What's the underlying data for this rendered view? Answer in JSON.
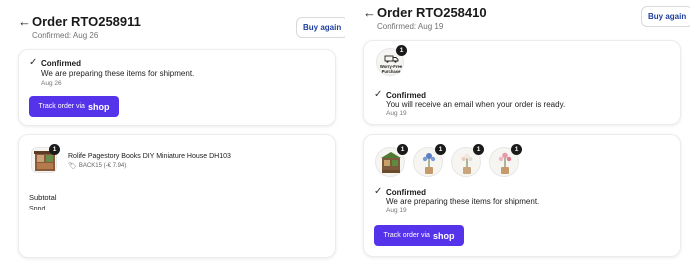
{
  "left_order": {
    "title": "Order RTO258911",
    "subtitle": "Confirmed: Aug 26",
    "buy_again": "Buy again",
    "status": {
      "title": "Confirmed",
      "message": "We are preparing these items for shipment.",
      "date": "Aug 26"
    },
    "track": {
      "label": "Track order via",
      "brand": "shop"
    },
    "item": {
      "quantity": "1",
      "name": "Rolife Pagestory Books DIY Miniature House DH103",
      "discount": "BACK15 (-€ 7.94)"
    },
    "subtotal_label": "Subtotal",
    "shipping_partial": "Sppd"
  },
  "right_order": {
    "title": "Order RTO258410",
    "subtitle": "Confirmed: Aug 19",
    "buy_again": "Buy again",
    "worry_free": {
      "quantity": "1",
      "line1": "Worry-Free",
      "line2": "Purchase"
    },
    "status_email": {
      "title": "Confirmed",
      "message": "You will receive an email when your order is ready.",
      "date": "Aug 19"
    },
    "items": [
      {
        "quantity": "1"
      },
      {
        "quantity": "1"
      },
      {
        "quantity": "1"
      },
      {
        "quantity": "1"
      }
    ],
    "status_ship": {
      "title": "Confirmed",
      "message": "We are preparing these items for shipment.",
      "date": "Aug 19"
    },
    "track": {
      "label": "Track order via",
      "brand": "shop"
    }
  },
  "icons": {
    "back": "back-arrow-icon",
    "check": "check-icon",
    "tag": "tag-icon"
  },
  "colors": {
    "accent": "#5433eb",
    "link": "#1f3f9e",
    "badge": "#1a1a1a"
  }
}
